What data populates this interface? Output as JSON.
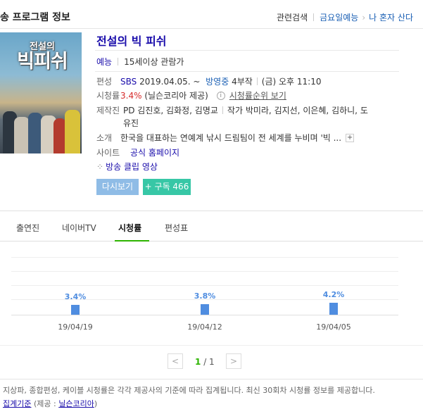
{
  "header": {
    "title": "송 프로그램 정보",
    "links": [
      "관련검색",
      "금요일예능",
      "나 혼자 산다"
    ]
  },
  "show": {
    "title": "전설의 빅 피쉬",
    "poster_small": "전설의",
    "poster_big": "빅피쉬",
    "genre": "예능",
    "rating": "15세이상 관람가",
    "broadcast": {
      "label": "편성",
      "channel": "SBS",
      "date": "2019.04.05. ~",
      "status": "방영중",
      "episodes": "4부작",
      "time": "(금) 오후 11:10"
    },
    "viewership": {
      "label": "시청률",
      "value": "3.4%",
      "source": "(닐슨코리아 제공)",
      "ranking_link": "시청률순위 보기"
    },
    "production": {
      "label": "제작진",
      "line1": "PD 김진호, 김화정, 김명교",
      "line1b": "작가 박미라, 김지선, 이은혜, 김하니, 도",
      "line2": "유진"
    },
    "intro": {
      "label": "소개",
      "text": "한국을 대표하는 연예계 낚시 드림팀이 전 세계를 누비며 '빅 ..."
    },
    "site": {
      "label": "사이트",
      "link": "공식 홈페이지"
    },
    "clip_link": "방송 클립 영상",
    "buttons": {
      "replay": "다시보기",
      "subscribe": "+ 구독 466"
    }
  },
  "tabs": [
    "출연진",
    "네이버TV",
    "시청률",
    "편성표"
  ],
  "active_tab": "시청률",
  "chart_data": {
    "type": "bar",
    "categories": [
      "19/04/19",
      "19/04/12",
      "19/04/05"
    ],
    "values": [
      3.4,
      3.8,
      4.2
    ],
    "labels": [
      "3.4%",
      "3.8%",
      "4.2%"
    ],
    "ylim": [
      0,
      10
    ],
    "grid": true,
    "color": "#4f8de0"
  },
  "pagination": {
    "current": "1",
    "total": "/ 1",
    "prev": "<",
    "next": ">"
  },
  "footer": {
    "notice": "지상파, 종합편성, 케이블 시청률은 각각 제공사의 기준에 따라 집계됩니다. 최신 30회차 시청률 정보를 제공합니다.",
    "agg_label": "집계기준",
    "agg_provider_prefix": "(제공 : ",
    "agg_provider": "닐슨코리아",
    "agg_provider_suffix": ")"
  }
}
